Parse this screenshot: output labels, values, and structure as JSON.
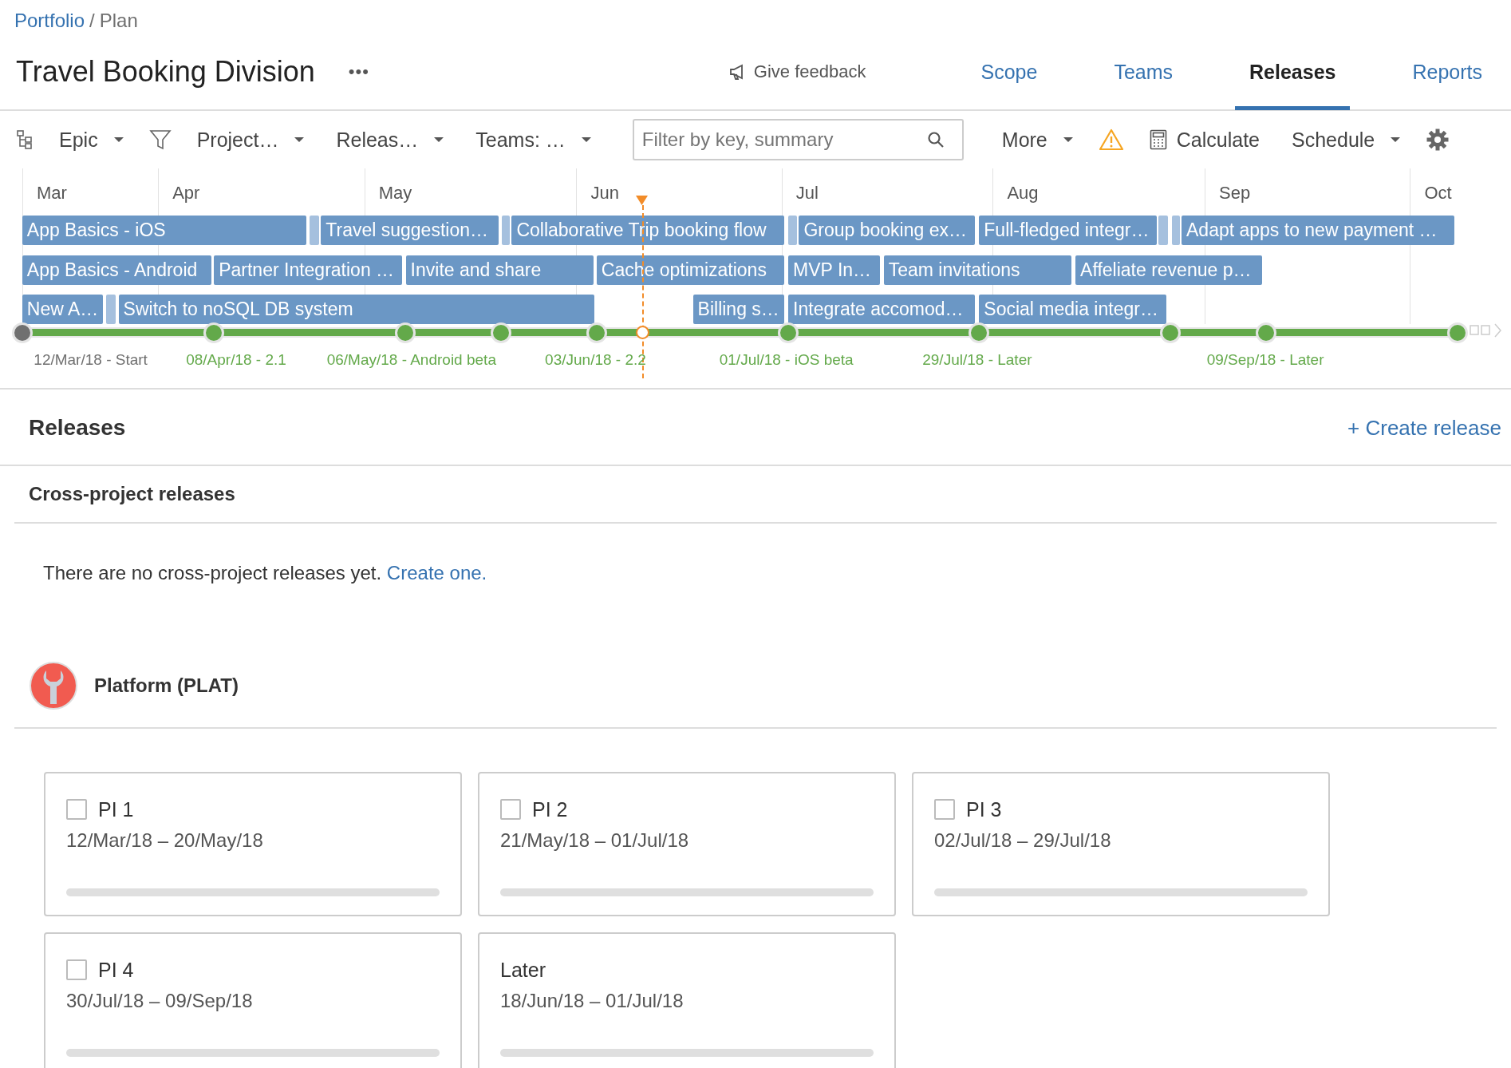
{
  "breadcrumb": {
    "link": "Portfolio",
    "separator": "/",
    "current": "Plan"
  },
  "title": "Travel Booking Division",
  "more_menu": "•••",
  "feedback": "Give feedback",
  "tabs": [
    {
      "label": "Scope",
      "selected": false
    },
    {
      "label": "Teams",
      "selected": false
    },
    {
      "label": "Releases",
      "selected": true
    },
    {
      "label": "Reports",
      "selected": false
    }
  ],
  "toolbar": {
    "hierarchy": "Epic",
    "filters": [
      "Project…",
      "Releas…",
      "Teams: …"
    ],
    "search": {
      "placeholder": "Filter by key, summary"
    },
    "more": "More",
    "calculate": "Calculate",
    "schedule": "Schedule"
  },
  "timeline": {
    "months": [
      "Mar",
      "Apr",
      "May",
      "Jun",
      "Jul",
      "Aug",
      "Sep",
      "Oct"
    ],
    "bars": [
      "App Basics - iOS",
      "Travel suggestion…",
      "Collaborative Trip booking flow",
      "Group booking ex…",
      "Full-fledged integr…",
      "Adapt apps to new payment …",
      "App Basics - Android",
      "Partner Integration …",
      "Invite and share",
      "Cache optimizations",
      "MVP In…",
      "Team invitations",
      "Affeliate revenue p…",
      "New A…",
      "Switch to noSQL DB system",
      "Billing s…",
      "Integrate accomod…",
      "Social media integr…"
    ],
    "milestones": [
      {
        "label": "12/Mar/18 - Start",
        "color": "#707070"
      },
      {
        "label": "08/Apr/18 - 2.1",
        "color": "#63a94a"
      },
      {
        "label": "06/May/18 - Android beta",
        "color": "#63a94a"
      },
      {
        "color": "#63a94a"
      },
      {
        "label": "03/Jun/18 - 2.2",
        "color": "#63a94a"
      },
      {
        "label": "01/Jul/18 - iOS beta",
        "color": "#63a94a"
      },
      {
        "label": "29/Jul/18 - Later",
        "color": "#63a94a"
      },
      {
        "color": "#63a94a"
      },
      {
        "label": "09/Sep/18 - Later",
        "color": "#63a94a"
      },
      {
        "color": "#63a94a"
      }
    ]
  },
  "releases": {
    "heading": "Releases",
    "create": "+ Create release",
    "cross_project": {
      "heading": "Cross-project releases",
      "empty_text": "There are no cross-project releases yet.",
      "link": "Create one."
    },
    "project": {
      "name": "Platform (PLAT)"
    },
    "cards": [
      {
        "kind": "release",
        "title": "PI 1",
        "dates": "12/Mar/18 – 20/May/18",
        "checked": false,
        "level": 0
      },
      {
        "kind": "release",
        "title": "PI 2",
        "dates": "21/May/18 – 01/Jul/18",
        "checked": false,
        "level": 0
      },
      {
        "kind": "release",
        "title": "PI 3",
        "dates": "02/Jul/18 – 29/Jul/18",
        "checked": false,
        "level": 0
      },
      {
        "kind": "release",
        "title": "PI 4",
        "dates": "30/Jul/18 – 09/Sep/18",
        "checked": false,
        "level": 0
      },
      {
        "kind": "later",
        "title": "Later",
        "dates": "18/Jun/18 – 01/Jul/18",
        "level": 0
      }
    ]
  }
}
